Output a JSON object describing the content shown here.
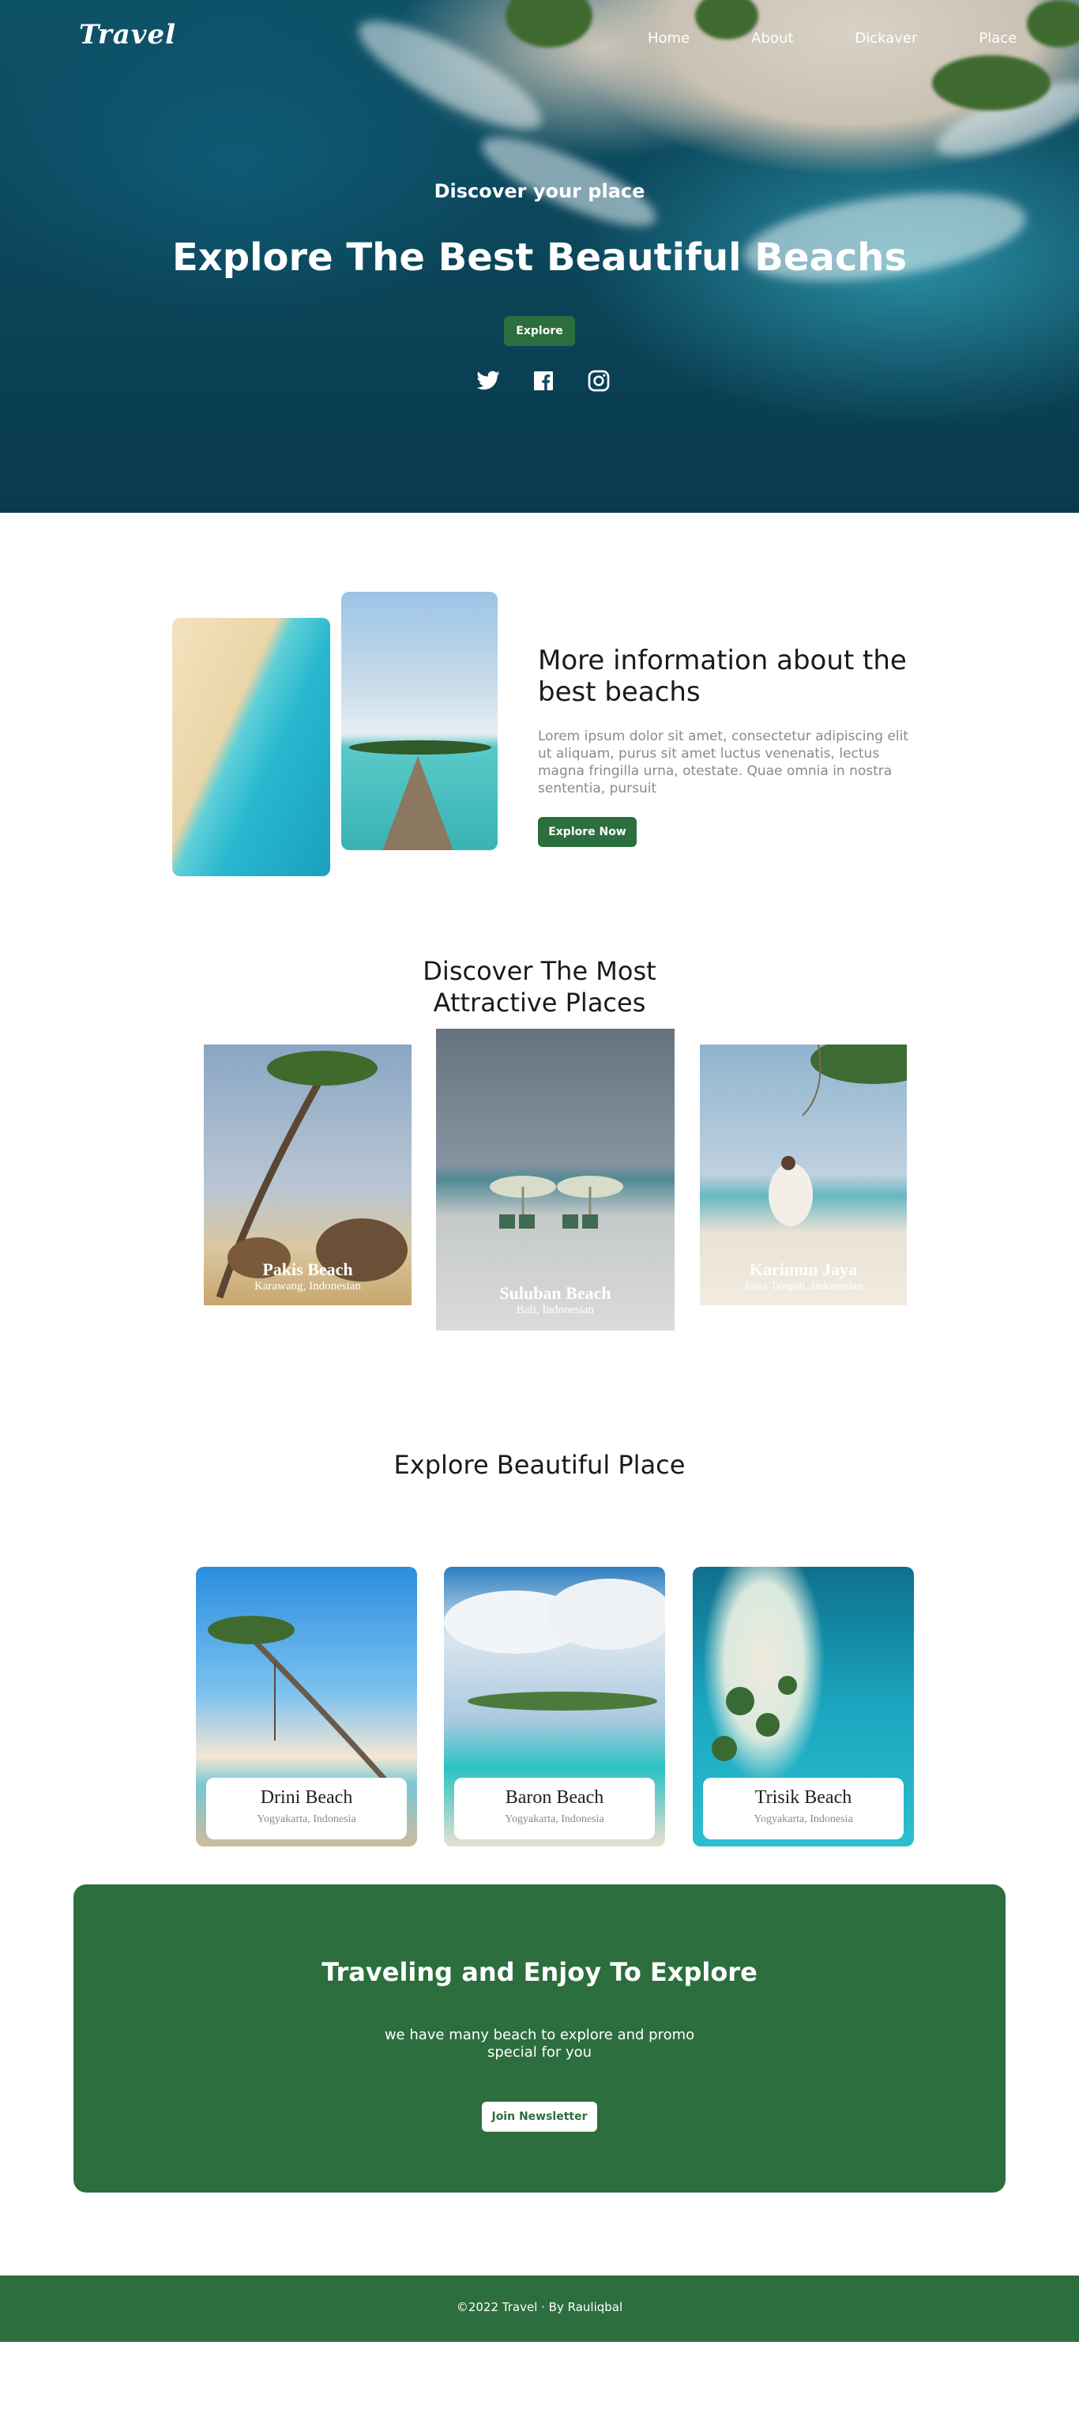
{
  "nav": {
    "logo": "Travel",
    "links": [
      "Home",
      "About",
      "Dickaver",
      "Place"
    ]
  },
  "hero": {
    "subtitle": "Discover your place",
    "title": "Explore The Best Beautiful Beachs",
    "button": "Explore",
    "socials": [
      "twitter-icon",
      "facebook-icon",
      "instagram-icon"
    ]
  },
  "info": {
    "title": "More information about the best beachs",
    "text": "Lorem ipsum dolor sit amet, consectetur adipiscing elit ut aliquam, purus sit amet luctus venenatis, lectus magna fringilla urna, otestate. Quae omnia in nostra sententia, pursuit",
    "button": "Explore Now"
  },
  "discover": {
    "title": "Discover The Most Attractive Places",
    "cards": [
      {
        "name": "Pakis Beach",
        "location": "Karawang, Indonesian"
      },
      {
        "name": "Suluban Beach",
        "location": "Bali, Indonesian"
      },
      {
        "name": "Karimun Jaya",
        "location": "Jawa Tengah, Indonesian"
      }
    ]
  },
  "explore": {
    "title": "Explore Beautiful Place",
    "cards": [
      {
        "name": "Drini Beach",
        "location": "Yogyakarta, Indonesia"
      },
      {
        "name": "Baron Beach",
        "location": "Yogyakarta, Indonesia"
      },
      {
        "name": "Trisik Beach",
        "location": "Yogyakarta, Indonesia"
      }
    ]
  },
  "newsletter": {
    "title": "Traveling and Enjoy To Explore",
    "text": "we have many beach to explore and promo special for you",
    "button": "Join Newsletter"
  },
  "footer": {
    "text": "©2022 Travel · By Rauliqbal"
  },
  "colors": {
    "accent": "#2c6e3d",
    "text": "#1a1a1a",
    "muted": "#8a8a8a"
  }
}
